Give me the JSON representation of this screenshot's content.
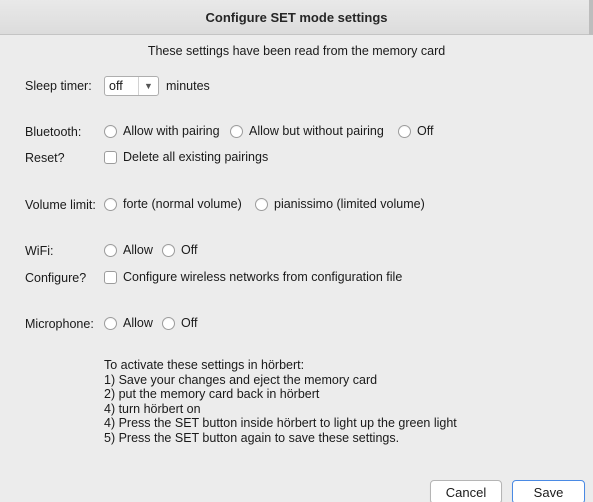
{
  "window": {
    "title": "Configure SET mode settings"
  },
  "subtitle": "These settings have been read from the memory card",
  "sleep": {
    "label": "Sleep timer:",
    "value": "off",
    "unit": "minutes"
  },
  "bluetooth": {
    "label": "Bluetooth:",
    "options": [
      "Allow with pairing",
      "Allow but without pairing",
      "Off"
    ]
  },
  "reset": {
    "label": "Reset?",
    "checkbox": "Delete all existing pairings"
  },
  "volume": {
    "label": "Volume limit:",
    "options": [
      "forte (normal volume)",
      "pianissimo (limited volume)"
    ]
  },
  "wifi": {
    "label": "WiFi:",
    "options": [
      "Allow",
      "Off"
    ]
  },
  "configure": {
    "label": "Configure?",
    "checkbox": "Configure wireless networks from configuration file"
  },
  "microphone": {
    "label": "Microphone:",
    "options": [
      "Allow",
      "Off"
    ]
  },
  "instructions": [
    "To activate these settings in hörbert:",
    "1) Save your changes and eject the memory card",
    "2) put the memory card back in hörbert",
    "4) turn hörbert on",
    "4) Press the SET button inside hörbert to light up the green light",
    "5) Press the SET button again to save these settings."
  ],
  "buttons": {
    "cancel": "Cancel",
    "save": "Save"
  },
  "colors": {
    "accent": "#4a8ae4",
    "background": "#ececec"
  }
}
